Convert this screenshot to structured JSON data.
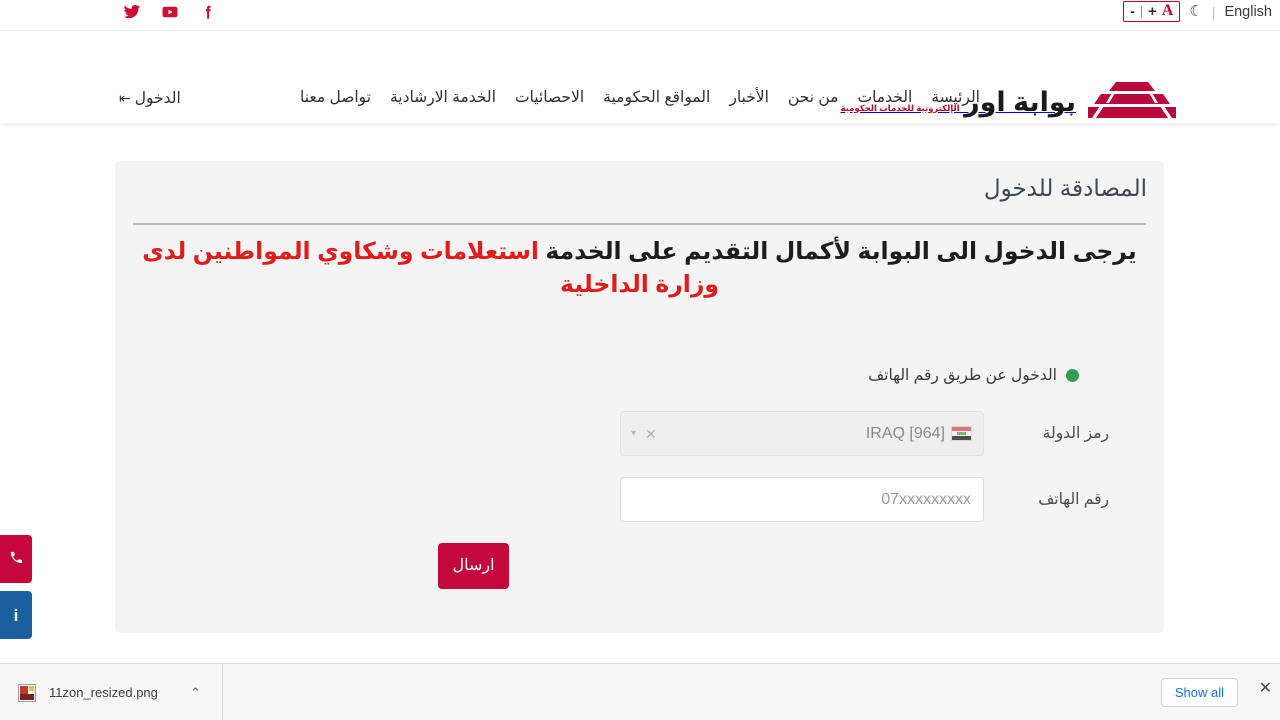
{
  "topbar": {
    "social": [
      {
        "name": "twitter-icon",
        "label": "Twitter"
      },
      {
        "name": "youtube-icon",
        "label": "YouTube"
      },
      {
        "name": "facebook-icon",
        "label": "Facebook"
      }
    ],
    "font_size": {
      "decrease": "-",
      "separator": "|",
      "increase": "+",
      "letter": "A"
    },
    "dark_mode_icon": "☾",
    "separator": "|",
    "language": "English",
    "accent_color": "#c4002b"
  },
  "header": {
    "logo": {
      "title": "بوابة اور",
      "subtitle": "الإلكترونية للخدمات الحكومية",
      "icon": "ziggurat-icon",
      "color": "#b9093a"
    },
    "nav": [
      {
        "label": "الرئيسة"
      },
      {
        "label": "الخدمات"
      },
      {
        "label": "من نحن"
      },
      {
        "label": "الأخبار"
      },
      {
        "label": "المواقع الحكومية"
      },
      {
        "label": "الاحصائيات"
      },
      {
        "label": "الخدمة الارشادية"
      },
      {
        "label": "تواصل معنا"
      }
    ],
    "login": {
      "label": "الدخول",
      "icon": "login-arrow-icon"
    }
  },
  "card": {
    "title": "المصادقة للدخول",
    "notice": {
      "part1": "يرجى الدخول الى البوابة لأكمال التقديم على الخدمة ",
      "highlight": "استعلامات وشكاوي المواطنين لدى وزارة الداخلية",
      "highlight_color": "#e21b1b"
    },
    "radio": {
      "label": "الدخول عن طريق رقم الهاتف",
      "selected": true,
      "color": "#2e9e4f"
    },
    "fields": {
      "country": {
        "label": "رمز الدولة",
        "value": "IRAQ [964]",
        "flag": "iraq-flag-icon",
        "clear_icon": "✕",
        "caret_icon": "▾"
      },
      "phone": {
        "label": "رقم الهاتف",
        "value": "",
        "placeholder": "07xxxxxxxxx"
      }
    },
    "submit": {
      "label": "ارسال",
      "color": "#c4083c"
    }
  },
  "side_tabs": [
    {
      "name": "phone-tab",
      "icon": "phone-icon",
      "glyph": "✆",
      "color": "#c4083c"
    },
    {
      "name": "info-tab",
      "icon": "info-icon",
      "glyph": "i",
      "color": "#1c5f9e"
    }
  ],
  "download_bar": {
    "file_name": "11zon_resized.png",
    "file_icon": "png-file-icon",
    "chevron": "⌃",
    "show_all_label": "Show all",
    "close_label": "✕"
  }
}
